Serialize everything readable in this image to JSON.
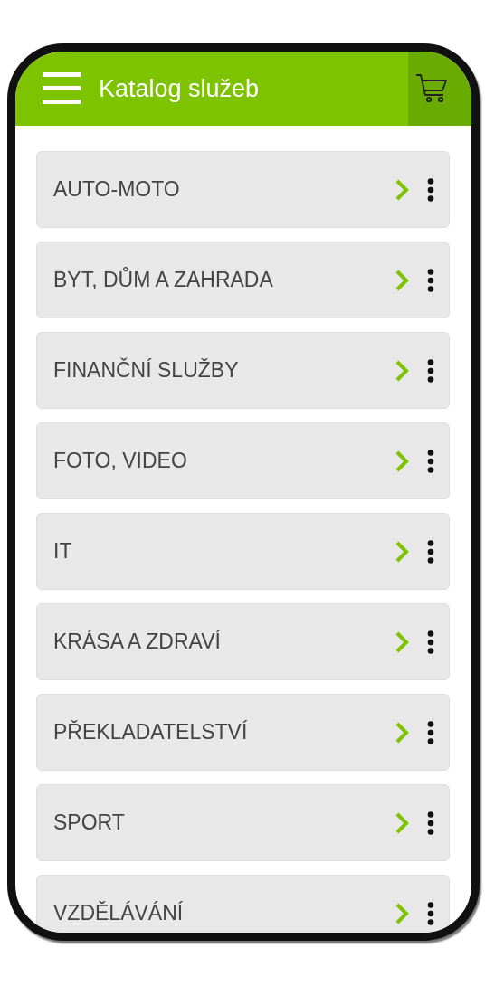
{
  "app_bar": {
    "title": "Katalog služeb"
  },
  "categories": [
    {
      "label": "AUTO-MOTO"
    },
    {
      "label": "BYT, DŮM A ZAHRADA"
    },
    {
      "label": "FINANČNÍ SLUŽBY"
    },
    {
      "label": "FOTO, VIDEO"
    },
    {
      "label": "IT"
    },
    {
      "label": "KRÁSA A ZDRAVÍ"
    },
    {
      "label": "PŘEKLADATELSTVÍ"
    },
    {
      "label": "SPORT"
    },
    {
      "label": "VZDĚLÁVÁNÍ"
    }
  ]
}
